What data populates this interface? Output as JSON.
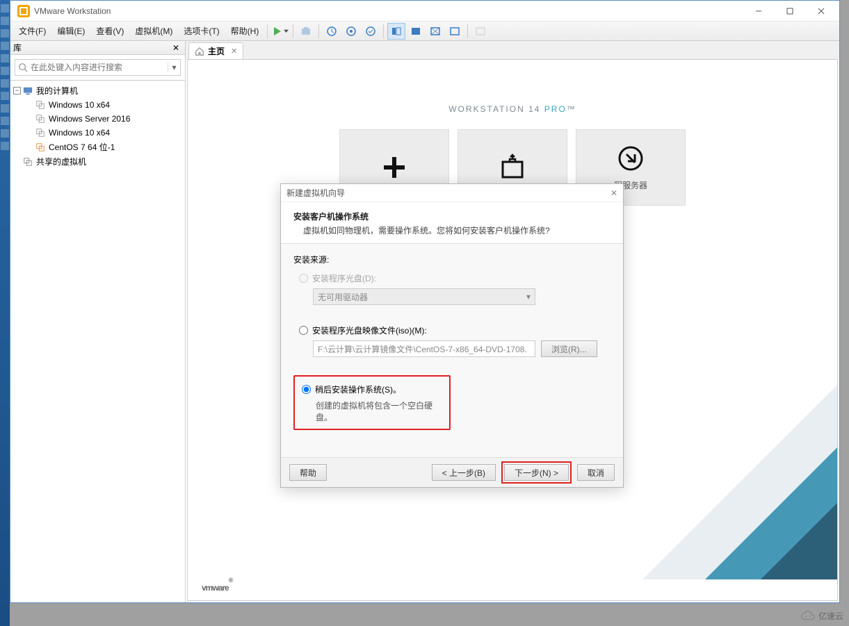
{
  "titlebar": {
    "title": "VMware Workstation"
  },
  "menu": {
    "file": "文件(F)",
    "edit": "编辑(E)",
    "view": "查看(V)",
    "vm": "虚拟机(M)",
    "tabs": "选项卡(T)",
    "help": "帮助(H)"
  },
  "sidebar": {
    "title": "库",
    "searchPlaceholder": "在此处键入内容进行搜索",
    "root": "我的计算机",
    "items": [
      "Windows 10 x64",
      "Windows Server 2016",
      "Windows 10 x64",
      "CentOS 7 64 位-1"
    ],
    "shared": "共享的虚拟机"
  },
  "tab": {
    "home": "主页"
  },
  "workspace": {
    "title1": "WORKSTATION 14 ",
    "title2": "PRO",
    "title3": "™",
    "card3": "程服务器",
    "logo": "vmware"
  },
  "wizard": {
    "window": "新建虚拟机向导",
    "h1": "安装客户机操作系统",
    "sub": "虚拟机如同物理机，需要操作系统。您将如何安装客户机操作系统?",
    "sourceLabel": "安装来源:",
    "opt1": "安装程序光盘(D):",
    "drive": "无可用驱动器",
    "opt2": "安装程序光盘映像文件(iso)(M):",
    "isoPath": "F:\\云计算\\云计算镜像文件\\CentOS-7-x86_64-DVD-1708.",
    "browse": "浏览(R)...",
    "opt3": "稍后安装操作系统(S)。",
    "opt3desc": "创建的虚拟机将包含一个空白硬盘。",
    "help": "帮助",
    "back": "< 上一步(B)",
    "next": "下一步(N) >",
    "cancel": "取消"
  },
  "watermark": "亿速云"
}
